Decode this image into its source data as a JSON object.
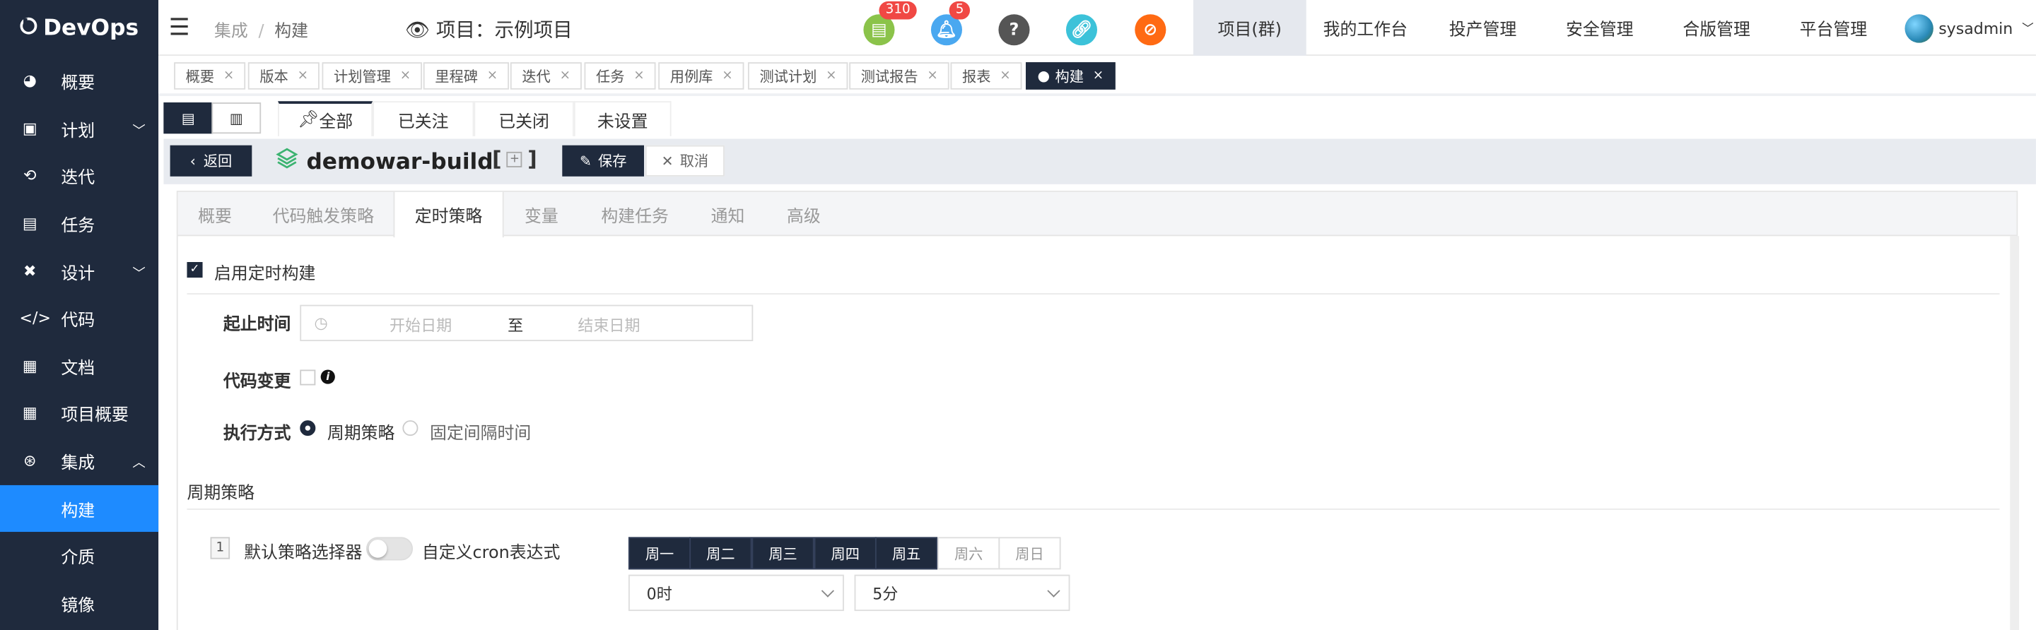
{
  "app": {
    "logo_text": "DevOps"
  },
  "sidebar": {
    "items": [
      {
        "label": "概要",
        "icon": "dashboard-icon"
      },
      {
        "label": "计划",
        "icon": "plan-icon"
      },
      {
        "label": "迭代",
        "icon": "iteration-icon"
      },
      {
        "label": "任务",
        "icon": "task-icon"
      },
      {
        "label": "设计",
        "icon": "design-icon"
      },
      {
        "label": "代码",
        "icon": "code-icon"
      },
      {
        "label": "文档",
        "icon": "document-icon"
      },
      {
        "label": "项目概要",
        "icon": "document-icon"
      },
      {
        "label": "集成",
        "icon": "integration-icon"
      }
    ],
    "subitems": [
      {
        "label": "构建"
      },
      {
        "label": "介质"
      },
      {
        "label": "镜像"
      }
    ]
  },
  "topbar": {
    "breadcrumb": [
      "集成",
      "构建"
    ],
    "project_label": "项目：示例项目",
    "badges": {
      "tasks": "310",
      "notifications": "5"
    },
    "nav": [
      "项目(群)",
      "我的工作台",
      "投产管理",
      "安全管理",
      "合版管理",
      "平台管理"
    ],
    "user": "sysadmin"
  },
  "page_tabs": [
    "概要",
    "版本",
    "计划管理",
    "里程碑",
    "迭代",
    "任务",
    "用例库",
    "测试计划",
    "测试报告",
    "报表",
    "构建"
  ],
  "filter_tabs": [
    "全部",
    "已关注",
    "已关闭",
    "未设置"
  ],
  "header": {
    "back_label": "返回",
    "title": "demowar-build",
    "bracket_open": "[",
    "bracket_close": "]",
    "plus": "+",
    "save_label": "保存",
    "cancel_label": "取消"
  },
  "settings_tabs": [
    "概要",
    "代码触发策略",
    "定时策略",
    "变量",
    "构建任务",
    "通知",
    "高级"
  ],
  "form": {
    "enable_label": "启用定时构建",
    "range_label": "起止时间",
    "start_placeholder": "开始日期",
    "range_sep": "至",
    "end_placeholder": "结束日期",
    "code_change_label": "代码变更",
    "exec_label": "执行方式",
    "exec_options": [
      "周期策略",
      "固定间隔时间"
    ],
    "section_title": "周期策略",
    "rule_index": "1",
    "default_selector_label": "默认策略选择器",
    "cron_label": "自定义cron表达式",
    "weekdays": [
      "周一",
      "周二",
      "周三",
      "周四",
      "周五",
      "周六",
      "周日"
    ],
    "weekdays_selected": [
      true,
      true,
      true,
      true,
      true,
      false,
      false
    ],
    "hour_value": "0时",
    "minute_value": "5分"
  }
}
